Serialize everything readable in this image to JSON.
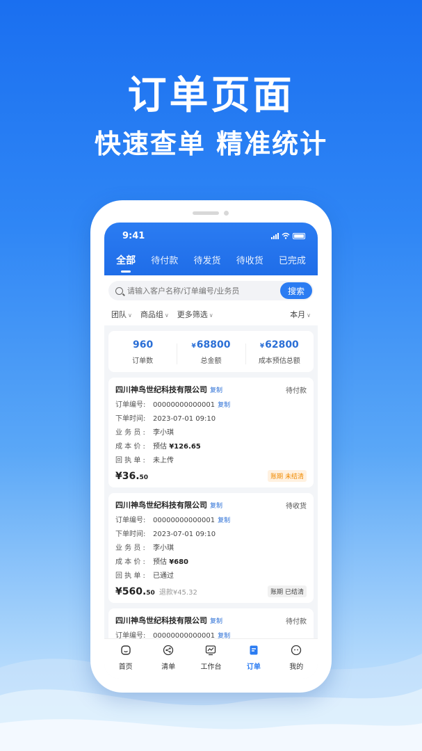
{
  "hero": {
    "title": "订单页面",
    "subtitle": "快速查单 精准统计"
  },
  "status_bar": {
    "time": "9:41"
  },
  "tabs": [
    {
      "label": "全部"
    },
    {
      "label": "待付款"
    },
    {
      "label": "待发货"
    },
    {
      "label": "待收货"
    },
    {
      "label": "已完成"
    }
  ],
  "search": {
    "placeholder": "请输入客户名称/订单编号/业务员",
    "button": "搜索"
  },
  "filters": {
    "team": "团队",
    "product_group": "商品组",
    "more": "更多筛选",
    "period": "本月"
  },
  "summary": [
    {
      "value": "960",
      "label": "订单数",
      "currency": ""
    },
    {
      "value": "68800",
      "label": "总金额",
      "currency": "¥"
    },
    {
      "value": "62800",
      "label": "成本预估总额",
      "currency": "¥"
    }
  ],
  "labels": {
    "order_no": "订单编号:",
    "order_time": "下单时间:",
    "salesman": "业 务 员 :",
    "cost": "成 本 价 :",
    "receipt": "回 执 单 :",
    "copy": "复制",
    "estimate": "预估"
  },
  "orders": [
    {
      "company": "四川神鸟世纪科技有限公司",
      "status": "待付款",
      "order_no": "00000000000001",
      "time": "2023-07-01 09:10",
      "salesman": "李小琪",
      "cost": "¥126.65",
      "receipt": "未上传",
      "price_int": "¥36.",
      "price_dec": "50",
      "refund": "",
      "badge": "账期 未结清"
    },
    {
      "company": "四川神鸟世纪科技有限公司",
      "status": "待收货",
      "order_no": "00000000000001",
      "time": "2023-07-01 09:10",
      "salesman": "李小琪",
      "cost": "¥680",
      "receipt": "已通过",
      "price_int": "¥560.",
      "price_dec": "50",
      "refund": "退款¥45.32",
      "badge": "账期 已结清"
    },
    {
      "company": "四川神鸟世纪科技有限公司",
      "status": "待付款",
      "order_no": "00000000000001"
    }
  ],
  "nav": [
    {
      "label": "首页",
      "icon": "home-icon"
    },
    {
      "label": "清单",
      "icon": "share-icon"
    },
    {
      "label": "工作台",
      "icon": "chart-icon"
    },
    {
      "label": "订单",
      "icon": "order-icon"
    },
    {
      "label": "我的",
      "icon": "face-icon"
    }
  ],
  "colors": {
    "primary": "#2b7cf2",
    "accent_orange": "#f08a00"
  }
}
